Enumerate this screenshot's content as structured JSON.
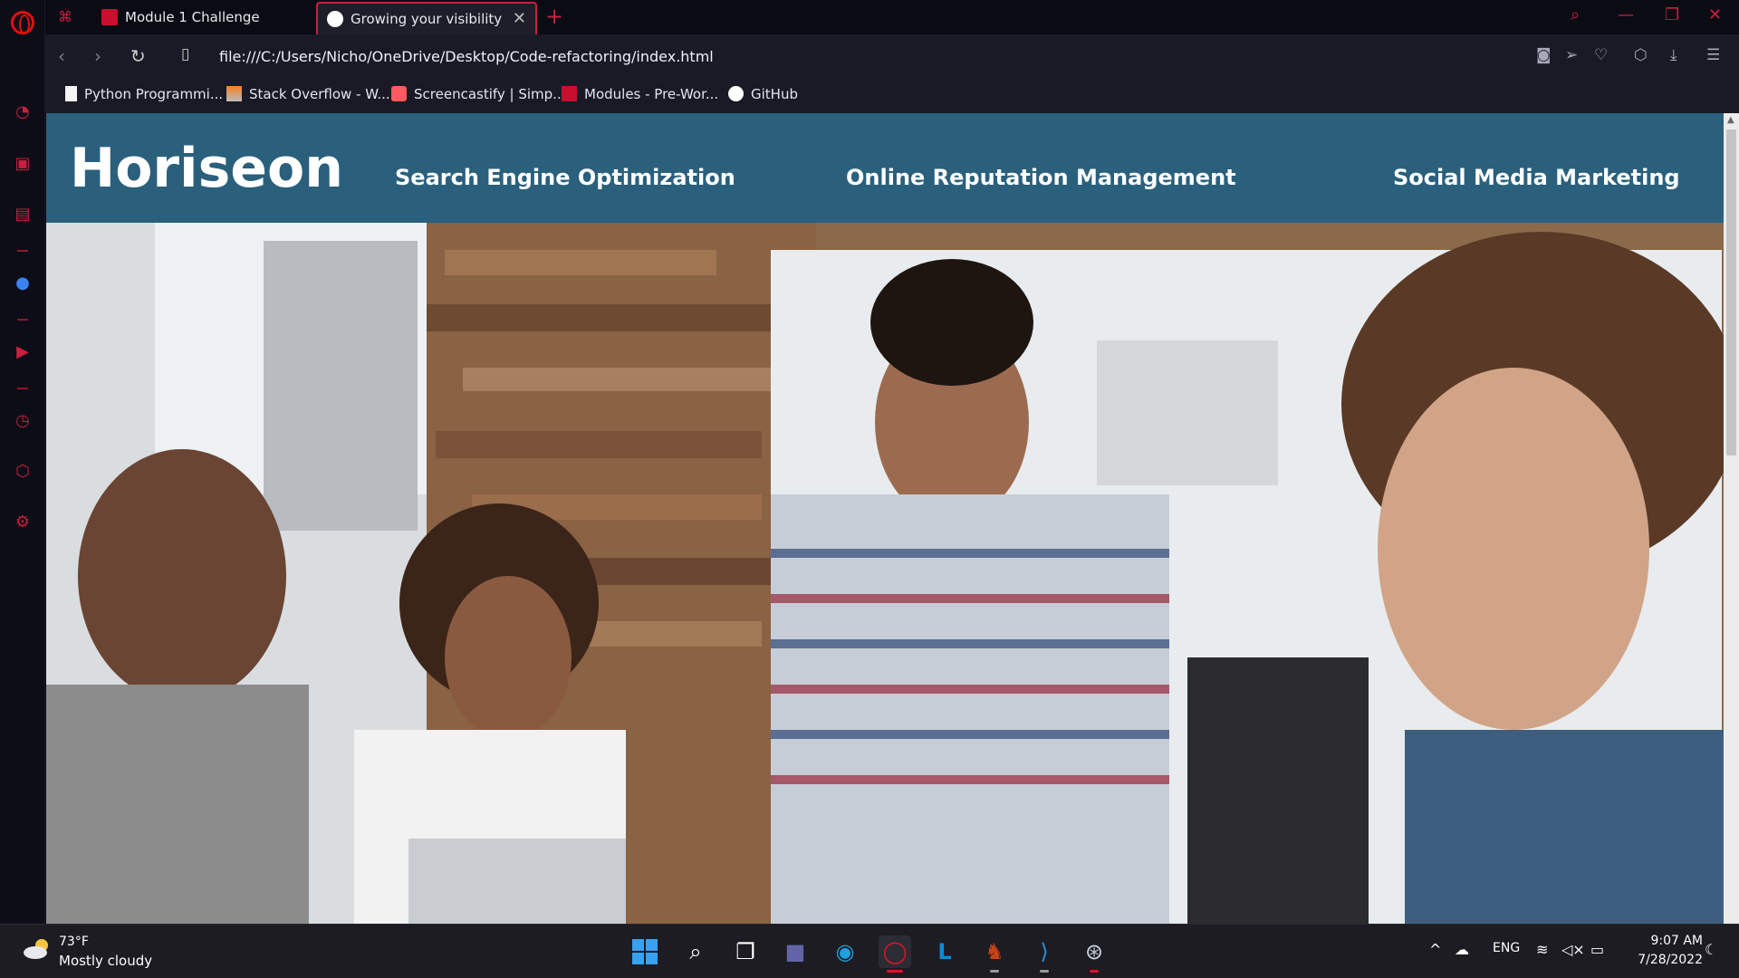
{
  "browser": {
    "tabs": [
      {
        "label": "Module 1 Challenge",
        "active": false
      },
      {
        "label": "Growing your visibility",
        "active": true
      }
    ],
    "url": "file:///C:/Users/Nicho/OneDrive/Desktop/Code-refactoring/index.html",
    "bookmarks": [
      {
        "label": "Python Programmi..."
      },
      {
        "label": "Stack Overflow - W..."
      },
      {
        "label": "Screencastify | Simp..."
      },
      {
        "label": "Modules - Pre-Wor..."
      },
      {
        "label": "GitHub"
      }
    ],
    "accent_color": "#c8203e"
  },
  "site": {
    "logo": "Horiseon",
    "nav": [
      {
        "label": "Search Engine Optimization"
      },
      {
        "label": "Online Reputation Management"
      },
      {
        "label": "Social Media Marketing"
      }
    ],
    "header_color": "#2a607c"
  },
  "taskbar": {
    "weather": {
      "temp": "73°F",
      "desc": "Mostly cloudy"
    },
    "language": "ENG",
    "time": "9:07 AM",
    "date": "7/28/2022"
  }
}
